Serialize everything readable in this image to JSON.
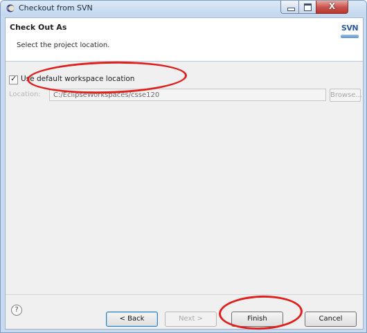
{
  "window": {
    "title": "Checkout from SVN",
    "controls": {
      "minimize_icon": "minimize-icon",
      "maximize_icon": "maximize-icon",
      "close_glyph": "X"
    }
  },
  "header": {
    "title": "Check Out As",
    "description": "Select the project location.",
    "logo_text": "SVN"
  },
  "form": {
    "use_default_label": "Use default workspace location",
    "use_default_checked": true,
    "location_label": "Location:",
    "location_value": "C:/EclipseWorkspaces/csse120",
    "browse_label": "Browse..."
  },
  "footer": {
    "help_glyph": "?",
    "back_label": "< Back",
    "next_label": "Next >",
    "finish_label": "Finish",
    "cancel_label": "Cancel"
  },
  "annotations": {
    "highlight_color": "#e0201c"
  }
}
